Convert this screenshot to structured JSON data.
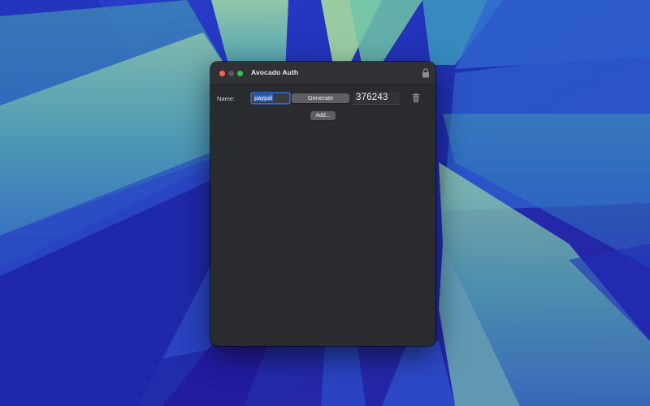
{
  "window": {
    "title": "Avocado Auth"
  },
  "entries": [
    {
      "label": "Name:",
      "name_value": "paypal",
      "generate_label": "Generate",
      "code": "376243"
    }
  ],
  "toolbar": {
    "add_label": "Add..."
  },
  "icons": {
    "lock": "lock-icon",
    "delete": "trash-icon"
  },
  "colors": {
    "close": "#ff5f57",
    "minimize": "#5a5b5f",
    "zoom": "#28c840",
    "focus_ring": "#2f6fd6",
    "window_bg": "#2a2b2f"
  }
}
